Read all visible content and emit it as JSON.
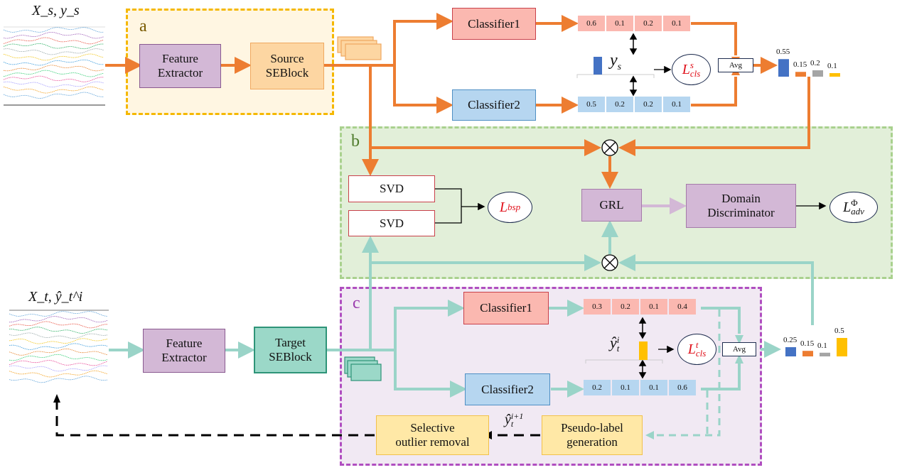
{
  "inputs": {
    "source_label": "X_s, y_s",
    "target_label": "X_t, ŷ_t^i"
  },
  "regions": {
    "a": {
      "label": "a",
      "border_color": "#f5b800",
      "fill": "#fff6e2"
    },
    "b": {
      "label": "b",
      "border_color": "#a9d18e",
      "fill": "#e2efd9"
    },
    "c": {
      "label": "c",
      "border_color": "#b04ec0",
      "fill": "#f1e9f3"
    }
  },
  "source_branch": {
    "feature_extractor": {
      "line1": "Feature",
      "line2": "Extractor"
    },
    "seblock": {
      "line1": "Source",
      "line2": "SEBlock"
    },
    "classifier1": "Classifier1",
    "classifier2": "Classifier2",
    "classifier1_probs": [
      "0.6",
      "0.1",
      "0.2",
      "0.1"
    ],
    "classifier2_probs": [
      "0.5",
      "0.2",
      "0.2",
      "0.1"
    ],
    "label_symbol": "y",
    "label_sub": "s",
    "loss": {
      "main": "L",
      "sup": "s",
      "sub": "cls"
    },
    "avg_label": "Avg",
    "avg_output": {
      "values": [
        "0.55",
        "0.15",
        "0.2",
        "0.1"
      ],
      "colors": [
        "#4472c4",
        "#ed7d31",
        "#a5a5a5",
        "#ffc000"
      ]
    }
  },
  "adversarial": {
    "svd1": "SVD",
    "svd2": "SVD",
    "bsp_loss": {
      "main": "L",
      "sub": "bsp"
    },
    "grl": "GRL",
    "discriminator": {
      "line1": "Domain",
      "line2": "Discriminator"
    },
    "adv_loss": {
      "main": "L",
      "sup": "Φ",
      "sub": "adv"
    },
    "multiply_symbol": "⊗"
  },
  "target_branch": {
    "feature_extractor": {
      "line1": "Feature",
      "line2": "Extractor"
    },
    "seblock": {
      "line1": "Target",
      "line2": "SEBlock"
    },
    "classifier1": "Classifier1",
    "classifier2": "Classifier2",
    "classifier1_probs": [
      "0.3",
      "0.2",
      "0.1",
      "0.4"
    ],
    "classifier2_probs": [
      "0.2",
      "0.1",
      "0.1",
      "0.6"
    ],
    "label_symbol": "ŷ",
    "label_sub": "t",
    "label_sup": "i",
    "loss": {
      "main": "L",
      "sup": "t",
      "sub": "cls"
    },
    "avg_label": "Avg",
    "avg_output": {
      "values": [
        "0.25",
        "0.15",
        "0.1",
        "0.5"
      ],
      "colors": [
        "#4472c4",
        "#ed7d31",
        "#a5a5a5",
        "#ffc000"
      ]
    },
    "pseudo_label": {
      "line1": "Pseudo-label",
      "line2": "generation"
    },
    "outlier_removal": {
      "line1": "Selective",
      "line2": "outlier removal"
    },
    "next_label": {
      "symbol": "ŷ",
      "sub": "t",
      "sup": "i+1"
    }
  },
  "colors": {
    "source_flow": "#ed7d31",
    "target_flow": "#9ad4c8",
    "feedback": "#000000",
    "loss_text": "#e0101a"
  }
}
